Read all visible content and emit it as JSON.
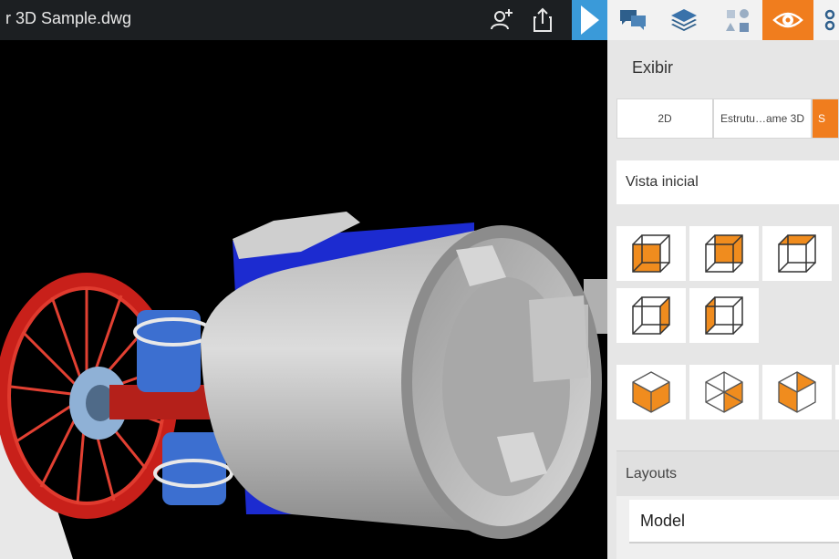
{
  "header": {
    "document_title": "r 3D Sample.dwg",
    "icons": [
      "add-user-icon",
      "share-icon",
      "expand-arrow-icon"
    ]
  },
  "panel": {
    "tabs": [
      {
        "name": "comments-icon",
        "active": false
      },
      {
        "name": "layers-icon",
        "active": false
      },
      {
        "name": "objects-icon",
        "active": false
      },
      {
        "name": "view-eye-icon",
        "active": true
      },
      {
        "name": "settings-icon",
        "active": false
      }
    ],
    "heading": "Exibir",
    "view_modes": [
      {
        "label": "2D",
        "active": false
      },
      {
        "label": "Estrutu…ame 3D",
        "active": false
      },
      {
        "label": "S",
        "active": true
      }
    ],
    "home_view_label": "Vista inicial",
    "layouts_label": "Layouts",
    "layout_selected": "Model"
  },
  "colors": {
    "accent": "#f07d1e",
    "topbar": "#1c1f22",
    "expand_button": "#3a9ad9",
    "panel_bg": "#e6e6e6"
  }
}
